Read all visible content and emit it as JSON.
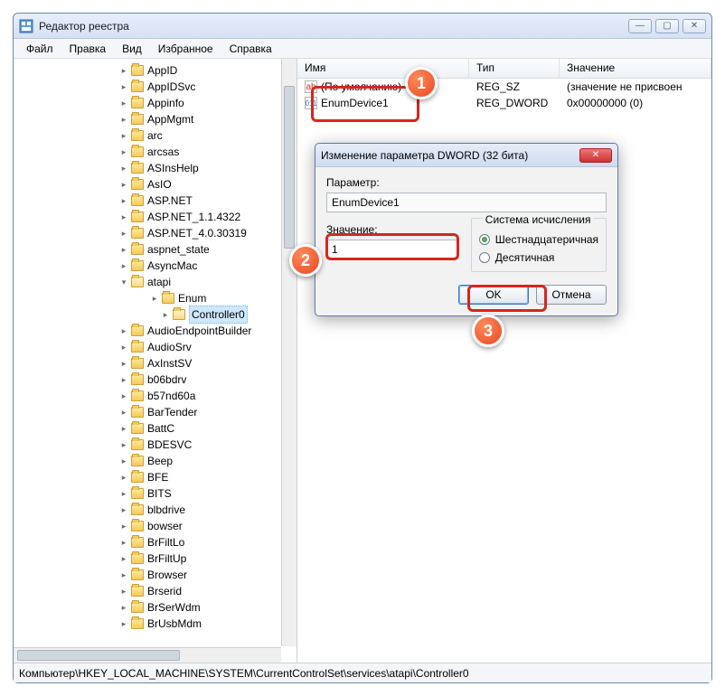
{
  "window": {
    "title": "Редактор реестра",
    "controls": {
      "min": "—",
      "max": "▢",
      "close": "✕"
    }
  },
  "menu": {
    "items": [
      "Файл",
      "Правка",
      "Вид",
      "Избранное",
      "Справка"
    ]
  },
  "tree": {
    "items": [
      {
        "label": "AppID",
        "level": 1
      },
      {
        "label": "AppIDSvc",
        "level": 1
      },
      {
        "label": "Appinfo",
        "level": 1
      },
      {
        "label": "AppMgmt",
        "level": 1
      },
      {
        "label": "arc",
        "level": 1
      },
      {
        "label": "arcsas",
        "level": 1
      },
      {
        "label": "ASInsHelp",
        "level": 1
      },
      {
        "label": "AsIO",
        "level": 1
      },
      {
        "label": "ASP.NET",
        "level": 1
      },
      {
        "label": "ASP.NET_1.1.4322",
        "level": 1
      },
      {
        "label": "ASP.NET_4.0.30319",
        "level": 1
      },
      {
        "label": "aspnet_state",
        "level": 1
      },
      {
        "label": "AsyncMac",
        "level": 1
      },
      {
        "label": "atapi",
        "level": 1,
        "expanded": true,
        "open": true
      },
      {
        "label": "Enum",
        "level": 2
      },
      {
        "label": "Controller0",
        "level": 3,
        "selected": true,
        "open": true
      },
      {
        "label": "AudioEndpointBuilder",
        "level": 1
      },
      {
        "label": "AudioSrv",
        "level": 1
      },
      {
        "label": "AxInstSV",
        "level": 1
      },
      {
        "label": "b06bdrv",
        "level": 1
      },
      {
        "label": "b57nd60a",
        "level": 1
      },
      {
        "label": "BarTender",
        "level": 1
      },
      {
        "label": "BattC",
        "level": 1
      },
      {
        "label": "BDESVC",
        "level": 1
      },
      {
        "label": "Beep",
        "level": 1
      },
      {
        "label": "BFE",
        "level": 1
      },
      {
        "label": "BITS",
        "level": 1
      },
      {
        "label": "blbdrive",
        "level": 1
      },
      {
        "label": "bowser",
        "level": 1
      },
      {
        "label": "BrFiltLo",
        "level": 1
      },
      {
        "label": "BrFiltUp",
        "level": 1
      },
      {
        "label": "Browser",
        "level": 1
      },
      {
        "label": "Brserid",
        "level": 1
      },
      {
        "label": "BrSerWdm",
        "level": 1
      },
      {
        "label": "BrUsbMdm",
        "level": 1
      }
    ]
  },
  "list": {
    "columns": {
      "name": "Имя",
      "type": "Тип",
      "value": "Значение"
    },
    "rows": [
      {
        "icon": "sz",
        "name": "(По умолчанию)",
        "type": "REG_SZ",
        "value": "(значение не присвоен"
      },
      {
        "icon": "dw",
        "name": "EnumDevice1",
        "type": "REG_DWORD",
        "value": "0x00000000 (0)"
      }
    ]
  },
  "dialog": {
    "title": "Изменение параметра DWORD (32 бита)",
    "param_label": "Параметр:",
    "param_value": "EnumDevice1",
    "value_label": "Значение:",
    "value_input": "1",
    "base_legend": "Система исчисления",
    "base_hex": "Шестнадцатеричная",
    "base_dec": "Десятичная",
    "ok": "OK",
    "cancel": "Отмена"
  },
  "statusbar": {
    "path": "Компьютер\\HKEY_LOCAL_MACHINE\\SYSTEM\\CurrentControlSet\\services\\atapi\\Controller0"
  },
  "markers": {
    "m1": "1",
    "m2": "2",
    "m3": "3"
  },
  "icons": {
    "sz": "ab",
    "dw": "011\n110"
  }
}
